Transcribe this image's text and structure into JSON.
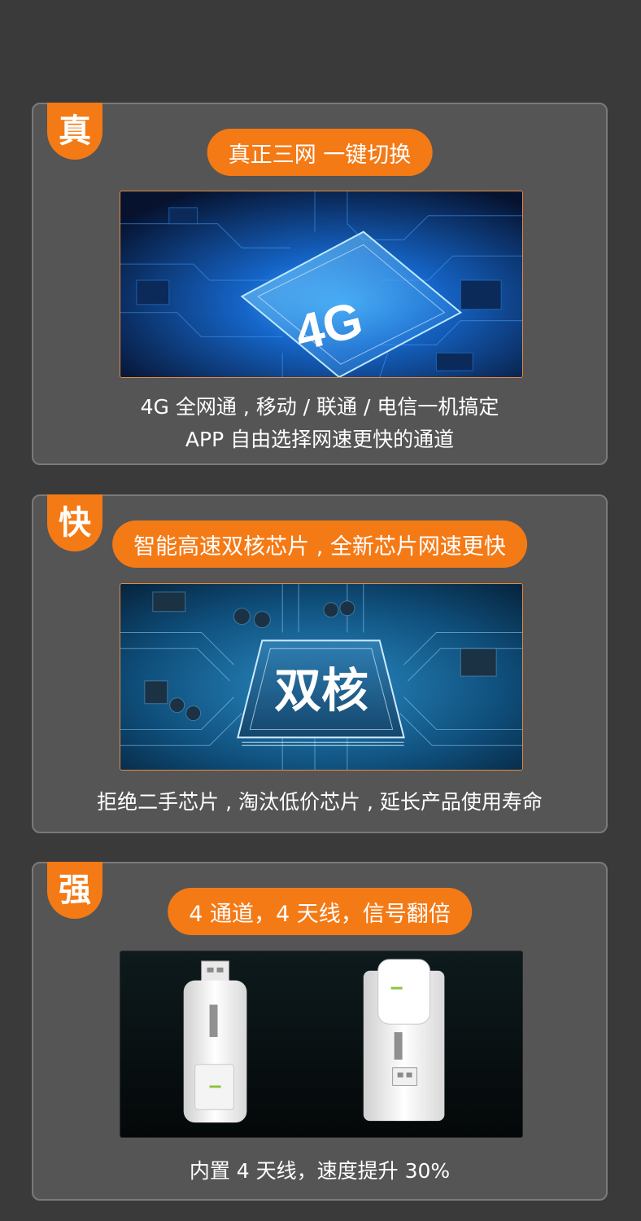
{
  "sections": [
    {
      "badge": "真",
      "pill": "真正三网 一键切换",
      "image_label": "4G",
      "caption_lines": [
        "4G 全网通 , 移动 / 联通 / 电信一机搞定",
        "APP 自由选择网速更快的通道"
      ]
    },
    {
      "badge": "快",
      "pill": "智能高速双核芯片 , 全新芯片网速更快",
      "image_label": "双核",
      "caption_lines": [
        "拒绝二手芯片 , 淘汰低价芯片 , 延长产品使用寿命"
      ]
    },
    {
      "badge": "强",
      "pill": "4 通道，4 天线，信号翻倍",
      "caption_lines": [
        "内置 4 天线，速度提升 30%"
      ]
    }
  ],
  "colors": {
    "accent": "#f47a16",
    "card": "#555555",
    "background": "#3a3a3a"
  }
}
